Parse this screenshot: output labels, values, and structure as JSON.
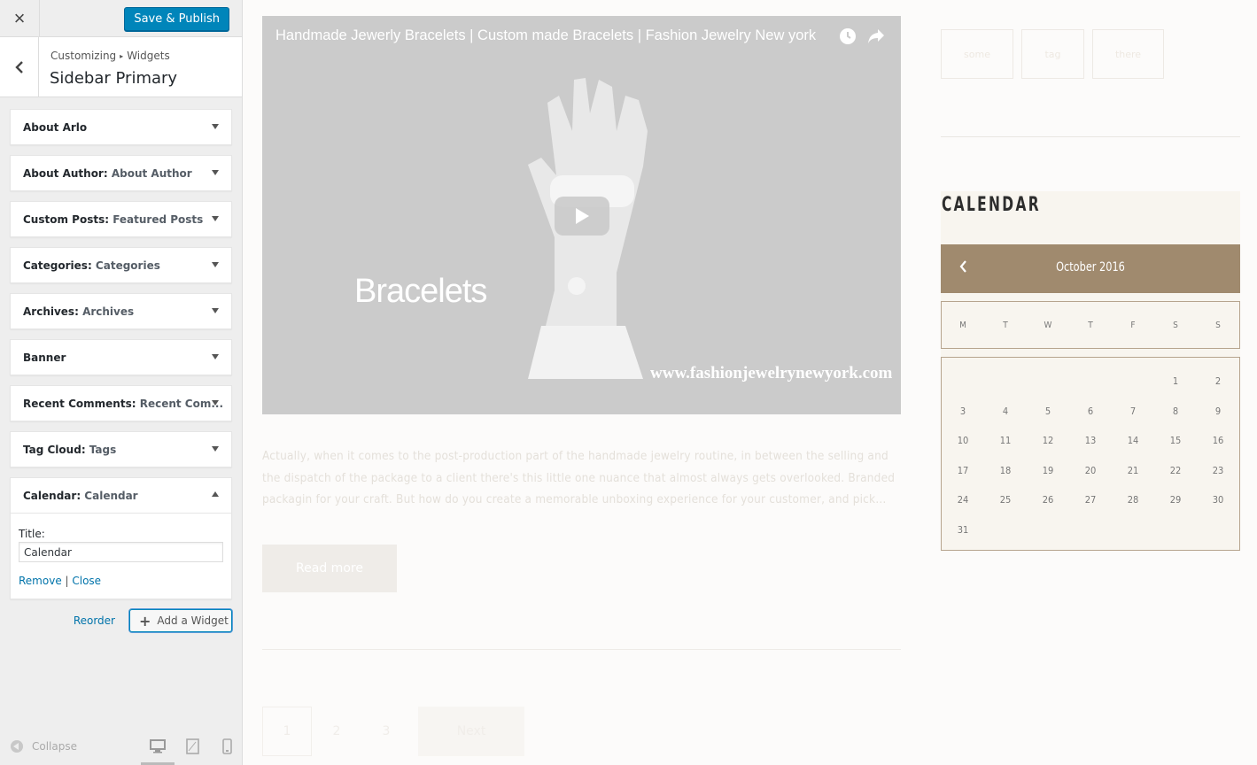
{
  "topbar": {
    "close_label": "×",
    "save_label": "Save & Publish"
  },
  "section": {
    "breadcrumb_root": "Customizing",
    "breadcrumb_separator": "▸",
    "breadcrumb_leaf": "Widgets",
    "title": "Sidebar Primary"
  },
  "widgets": [
    {
      "title": "About Arlo",
      "instance": ""
    },
    {
      "title": "About Author",
      "instance": "About Author"
    },
    {
      "title": "Custom Posts",
      "instance": "Featured Posts"
    },
    {
      "title": "Categories",
      "instance": "Categories"
    },
    {
      "title": "Archives",
      "instance": "Archives"
    },
    {
      "title": "Banner",
      "instance": ""
    },
    {
      "title": "Recent Comments",
      "instance": "Recent Com..."
    },
    {
      "title": "Tag Cloud",
      "instance": "Tags"
    },
    {
      "title": "Calendar",
      "instance": "Calendar"
    }
  ],
  "calendar_widget_form": {
    "field_label": "Title:",
    "field_value": "Calendar",
    "remove_label": "Remove",
    "link_separator": " | ",
    "close_label": "Close"
  },
  "widget_actions": {
    "reorder_label": "Reorder",
    "add_label": "Add a Widget"
  },
  "footer": {
    "collapse_label": "Collapse",
    "active_device": "desktop"
  },
  "preview": {
    "video": {
      "title": "Handmade Jewerly Bracelets | Custom made Bracelets | Fashion Jewelry New york",
      "overlay_text": "Bracelets",
      "overlay_url": "www.fashionjewelrynewyork.com"
    },
    "excerpt": "Actually, when it comes to the post-production part of the handmade jewelry routine, in between the selling and the dispatch of the package to a client there's this little one nuance that almost always gets overlooked. Branded packagin for your craft. But how do you create a memorable unboxing experience for your customer, and pick…",
    "read_more_label": "Read more",
    "pagination": [
      "1",
      "2",
      "3"
    ],
    "next_label": "Next",
    "tags": [
      "some",
      "tag",
      "there"
    ],
    "calendar": {
      "title": "CALENDAR",
      "month": "October 2016",
      "day_names": [
        "M",
        "T",
        "W",
        "T",
        "F",
        "S",
        "S"
      ],
      "weeks": [
        [
          "",
          "",
          "",
          "",
          "",
          "1",
          "2"
        ],
        [
          "3",
          "4",
          "5",
          "6",
          "7",
          "8",
          "9"
        ],
        [
          "10",
          "11",
          "12",
          "13",
          "14",
          "15",
          "16"
        ],
        [
          "17",
          "18",
          "19",
          "20",
          "21",
          "22",
          "23"
        ],
        [
          "24",
          "25",
          "26",
          "27",
          "28",
          "29",
          "30"
        ],
        [
          "31",
          "",
          "",
          "",
          "",
          "",
          ""
        ]
      ],
      "header_color": "#a08a6e"
    }
  },
  "colors": {
    "primary_button": "#0085ba",
    "link": "#0073aa",
    "sidebar_bg": "#eeeeee"
  }
}
